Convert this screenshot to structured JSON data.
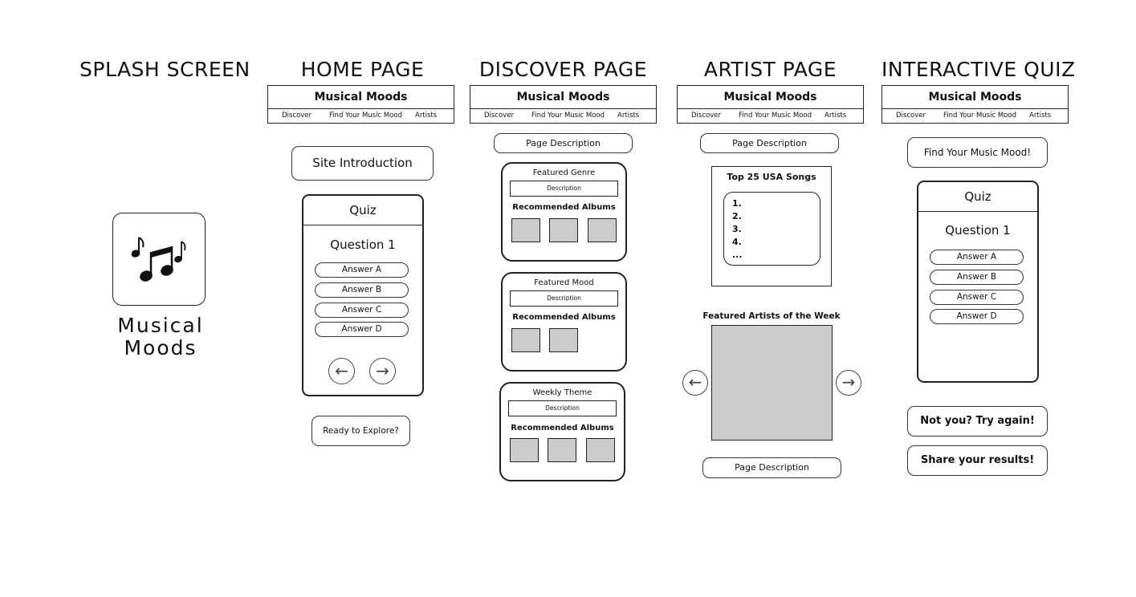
{
  "columns": {
    "splash": {
      "title": "SPLASH SCREEN"
    },
    "home": {
      "title": "HOME PAGE"
    },
    "discover": {
      "title": "DISCOVER PAGE"
    },
    "artist": {
      "title": "ARTIST PAGE"
    },
    "quiz": {
      "title": "INTERACTIVE QUIZ"
    }
  },
  "header": {
    "app_name": "Musical Moods",
    "nav": [
      "Discover",
      "Find Your Music Mood",
      "Artists"
    ]
  },
  "splash": {
    "logo_icon": "music-notes-icon",
    "name_line1": "Musical",
    "name_line2": "Moods"
  },
  "home": {
    "intro": "Site Introduction",
    "quiz_title": "Quiz",
    "question": "Question 1",
    "answers": [
      "Answer A",
      "Answer B",
      "Answer C",
      "Answer D"
    ],
    "prev_icon": "←",
    "next_icon": "→",
    "cta": "Ready to Explore?"
  },
  "discover": {
    "page_description": "Page Description",
    "cards": [
      {
        "title": "Featured Genre",
        "description": "Description",
        "rec": "Recommended Albums"
      },
      {
        "title": "Featured Mood",
        "description": "Description",
        "rec": "Recommended Albums"
      },
      {
        "title": "Weekly Theme",
        "description": "Description",
        "rec": "Recommended Albums"
      }
    ]
  },
  "artist": {
    "page_description": "Page Description",
    "top_title": "Top 25 USA Songs",
    "songs": [
      "1.",
      "2.",
      "3.",
      "4.",
      "..."
    ],
    "featured_title": "Featured Artists of the Week",
    "prev_icon": "←",
    "next_icon": "→",
    "page_description_bottom": "Page Description"
  },
  "quiz": {
    "heading": "Find Your Music Mood!",
    "quiz_title": "Quiz",
    "question": "Question 1",
    "answers": [
      "Answer A",
      "Answer B",
      "Answer C",
      "Answer D"
    ],
    "retry": "Not you? Try again!",
    "share": "Share your results!"
  }
}
